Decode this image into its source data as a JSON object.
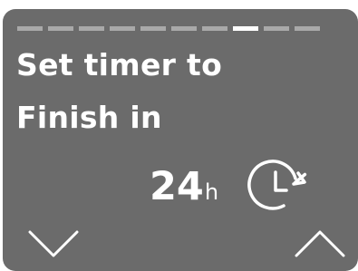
{
  "progress": {
    "total_steps": 10,
    "current_step": 8
  },
  "title": {
    "line1": "Set timer to",
    "line2": "Finish in"
  },
  "timer": {
    "value": "24",
    "unit": "h",
    "icon": "timer-clock-icon"
  },
  "controls": {
    "down_icon": "chevron-down-icon",
    "up_icon": "chevron-up-icon"
  },
  "colors": {
    "background": "#6b6b6b",
    "text": "#ffffff",
    "progress_inactive": "#a9a9a9",
    "progress_active": "#ffffff"
  }
}
